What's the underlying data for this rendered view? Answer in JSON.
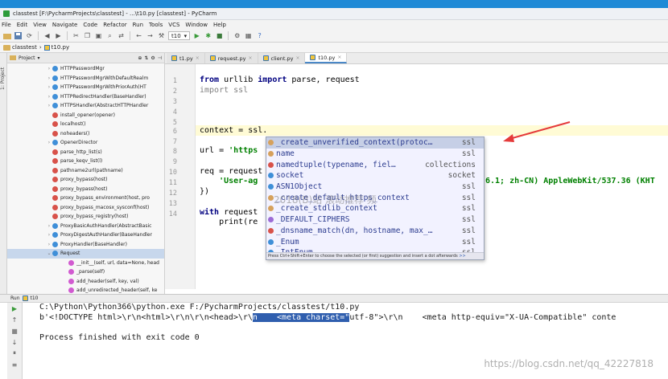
{
  "window": {
    "title": "classtest [F:\\PycharmProjects\\classtest] - ...\\t10.py [classtest] - PyCharm",
    "accent": "#1f8ad6"
  },
  "menu": [
    "File",
    "Edit",
    "View",
    "Navigate",
    "Code",
    "Refactor",
    "Run",
    "Tools",
    "VCS",
    "Window",
    "Help"
  ],
  "toolbar": {
    "run_config": "t10"
  },
  "breadcrumbs": [
    "classtest",
    "t10.py"
  ],
  "project_panel": {
    "title": "Project",
    "side_label": "1: Project",
    "items": [
      {
        "label": "HTTPPasswordMgr",
        "kind": "class",
        "arrow": "›"
      },
      {
        "label": "HTTPPasswordMgrWithDefaultRealm",
        "kind": "class",
        "arrow": "›"
      },
      {
        "label": "HTTPPasswordMgrWithPriorAuth(HT",
        "kind": "class",
        "arrow": "›"
      },
      {
        "label": "HTTPRedirectHandler(BaseHandler)",
        "kind": "class",
        "arrow": "›"
      },
      {
        "label": "HTTPSHandler(AbstractHTTPHandler",
        "kind": "class",
        "arrow": "›"
      },
      {
        "label": "install_opener(opener)",
        "kind": "func",
        "arrow": ""
      },
      {
        "label": "localhost()",
        "kind": "func",
        "arrow": ""
      },
      {
        "label": "noheaders()",
        "kind": "func",
        "arrow": ""
      },
      {
        "label": "OpenerDirector",
        "kind": "class",
        "arrow": "›"
      },
      {
        "label": "parse_http_list(s)",
        "kind": "func",
        "arrow": ""
      },
      {
        "label": "parse_keqv_list(l)",
        "kind": "func",
        "arrow": ""
      },
      {
        "label": "pathname2url(pathname)",
        "kind": "func",
        "arrow": ""
      },
      {
        "label": "proxy_bypass(host)",
        "kind": "func",
        "arrow": ""
      },
      {
        "label": "proxy_bypass(host)",
        "kind": "func",
        "arrow": ""
      },
      {
        "label": "proxy_bypass_environment(host, pro",
        "kind": "func",
        "arrow": ""
      },
      {
        "label": "proxy_bypass_macosx_sysconf(host)",
        "kind": "func",
        "arrow": ""
      },
      {
        "label": "proxy_bypass_registry(host)",
        "kind": "func",
        "arrow": ""
      },
      {
        "label": "ProxyBasicAuthHandler(AbstractBasic",
        "kind": "class",
        "arrow": "›"
      },
      {
        "label": "ProxyDigestAuthHandler(BaseHandler",
        "kind": "class",
        "arrow": "›"
      },
      {
        "label": "ProxyHandler(BaseHandler)",
        "kind": "class",
        "arrow": "›"
      },
      {
        "label": "Request",
        "kind": "class",
        "arrow": "⌄",
        "selected": true
      },
      {
        "label": "__init__(self, url, data=None, head",
        "kind": "method",
        "arrow": ""
      },
      {
        "label": "_parse(self)",
        "kind": "method",
        "arrow": ""
      },
      {
        "label": "add_header(self, key, val)",
        "kind": "method",
        "arrow": ""
      },
      {
        "label": "add_unredirected_header(self, ke",
        "kind": "method",
        "arrow": ""
      }
    ]
  },
  "tabs": [
    {
      "label": "t1.py",
      "active": false
    },
    {
      "label": "request.py",
      "active": false
    },
    {
      "label": "client.py",
      "active": false
    },
    {
      "label": "t10.py",
      "active": true
    }
  ],
  "editor": {
    "line_numbers": [
      "1",
      "2",
      "3",
      "4",
      "5",
      "6",
      "7",
      "8",
      "9",
      "10",
      "11",
      "12",
      "13",
      "14"
    ],
    "lines": {
      "l1_kw1": "from",
      "l1_mod": " urllib ",
      "l1_kw2": "import",
      "l1_rest": " parse, request",
      "l2_kw": "import",
      "l2_rest": " ssl",
      "l6": "context = ssl.",
      "l8_a": "url = ",
      "l8_b": "'https",
      "l10": "req = request",
      "l11": "    'User-ag",
      "l11_tail": "6.1; zh-CN) AppleWebKit/537.36 (KHT",
      "l12": "})",
      "l14_kw": "with",
      "l14_rest": " request",
      "l15": "    print(re"
    }
  },
  "completion": {
    "items": [
      {
        "name": "_create_unverified_context(protoc…",
        "type": "ssl",
        "icon": "prop",
        "selected": true
      },
      {
        "name": "name",
        "type": "ssl",
        "icon": "prop"
      },
      {
        "name": "namedtuple(typename, fiel…",
        "type": "collections",
        "icon": "func"
      },
      {
        "name": "socket",
        "type": "socket",
        "icon": "class"
      },
      {
        "name": "ASN1Object",
        "type": "ssl",
        "icon": "class"
      },
      {
        "name": "_create_default_https_context",
        "type": "ssl",
        "icon": "prop"
      },
      {
        "name": "_create_stdlib_context",
        "type": "ssl",
        "icon": "prop"
      },
      {
        "name": "_DEFAULT_CIPHERS",
        "type": "ssl",
        "icon": "var"
      },
      {
        "name": "_dnsname_match(dn, hostname, max_…",
        "type": "ssl",
        "icon": "func"
      },
      {
        "name": "_Enum",
        "type": "ssl",
        "icon": "class"
      },
      {
        "name": "_IntEnum",
        "type": "ssl",
        "icon": "class"
      }
    ],
    "hint": "Press Ctrl+Shift+Enter to choose the selected (or first) suggestion and insert a dot afterwards",
    "hint_link": ">>"
  },
  "watermark": "2018(B)站 滚动推荐 频",
  "run": {
    "tab_label": "Run",
    "config": "t10",
    "lines": [
      "C:\\Python\\Python366\\python.exe F:/PycharmProjects/classtest/t10.py",
      "b'<!DOCTYPE html>\\r\\n<html>\\r\\n\\r\\n<head>\\r\\",
      "n    <meta charset=\"",
      "utf-8\">\\r\\n    <meta http-equiv=\"X-UA-Compatible\" conte",
      "Process finished with exit code 0"
    ],
    "watermark": "https://blog.csdn.net/qq_42227818"
  }
}
